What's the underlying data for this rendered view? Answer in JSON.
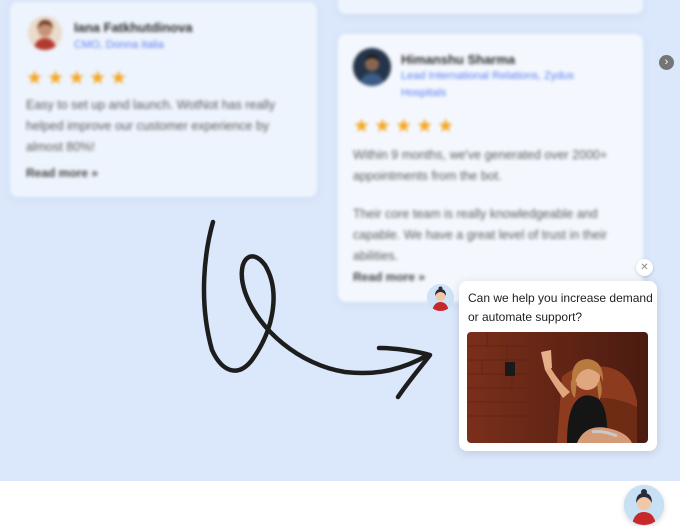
{
  "testimonials": [
    {
      "name": "Iana Fatkhutdinova",
      "role": "CMO, Donna italia",
      "rating": 5,
      "stars": "★★★★★",
      "text": "Easy to set up and launch. WotNot has really helped improve our customer experience by almost 80%!",
      "text_lines": [
        "Easy to set up and launch. WotNot has really",
        "helped improve our customer experience by",
        "almost 80%!"
      ],
      "read_more": "Read more »"
    },
    {
      "name": "Himanshu Sharma",
      "role": "Lead International Relations, Zydus Hospitals",
      "role_lines": [
        "Lead International Relations, Zydus",
        "Hospitals"
      ],
      "rating": 5,
      "stars": "★★★★★",
      "text_lines_1": [
        "Within 9 months, we've generated over 2000+",
        "appointments from the bot."
      ],
      "text_lines_2": [
        "Their core team is really knowledgeable and",
        "capable. We have a great level of trust in their",
        "abilities."
      ],
      "read_more": "Read more »"
    }
  ],
  "carousel": {
    "next_icon": "chevron-right-icon",
    "next_glyph": "›"
  },
  "chat": {
    "close_glyph": "✕",
    "message_lines": [
      "Can we help you increase demand",
      "or automate support?"
    ]
  },
  "colors": {
    "background": "#dbe8fb",
    "accent_link": "#5a7ff0",
    "star": "#f5a623"
  }
}
